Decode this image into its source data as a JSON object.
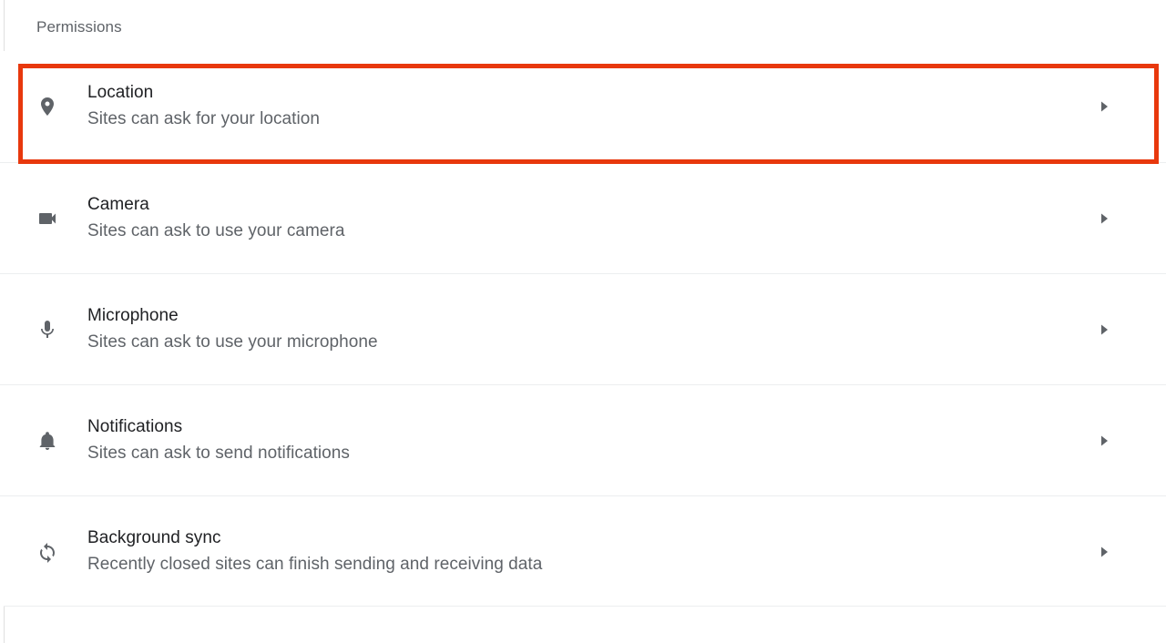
{
  "section": {
    "title": "Permissions"
  },
  "colors": {
    "highlight": "#e8380d",
    "title_text": "#202124",
    "secondary_text": "#5f6368",
    "divider": "#eceeef",
    "background": "#ffffff"
  },
  "rows": [
    {
      "icon": "location-pin-icon",
      "title": "Location",
      "subtitle": "Sites can ask for your location",
      "arrow": "chevron-right-icon",
      "highlighted": true
    },
    {
      "icon": "camera-icon",
      "title": "Camera",
      "subtitle": "Sites can ask to use your camera",
      "arrow": "chevron-right-icon",
      "highlighted": false
    },
    {
      "icon": "microphone-icon",
      "title": "Microphone",
      "subtitle": "Sites can ask to use your microphone",
      "arrow": "chevron-right-icon",
      "highlighted": false
    },
    {
      "icon": "bell-icon",
      "title": "Notifications",
      "subtitle": "Sites can ask to send notifications",
      "arrow": "chevron-right-icon",
      "highlighted": false
    },
    {
      "icon": "sync-icon",
      "title": "Background sync",
      "subtitle": "Recently closed sites can finish sending and receiving data",
      "arrow": "chevron-right-icon",
      "highlighted": false
    }
  ]
}
